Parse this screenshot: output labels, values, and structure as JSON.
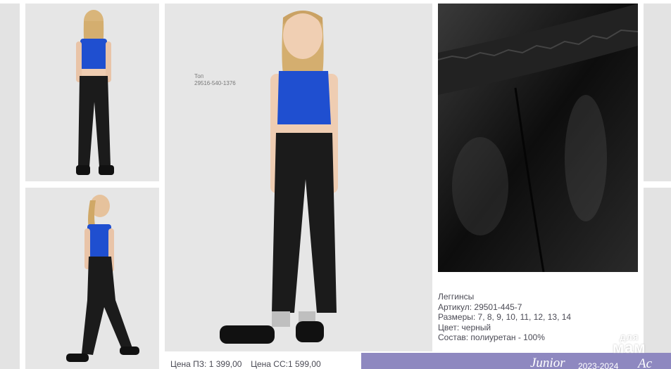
{
  "top_note": {
    "name": "Топ",
    "article": "29516-540-1376"
  },
  "product": {
    "name": "Леггинсы",
    "article": "Артикул: 29501-445-7",
    "sizes": "Размеры: 7, 8, 9, 10, 11, 12, 13, 14",
    "color": "Цвет: черный",
    "composition": "Состав: полиуретан - 100%"
  },
  "prices": {
    "pz": "Цена ПЗ: 1 399,00",
    "ss": "Цена СС:1 599,00"
  },
  "footer": {
    "brand": "Junior",
    "season": "2023-2024",
    "brand_right": "Ac"
  },
  "watermark": {
    "line1": "для",
    "line2": "мам"
  },
  "colors": {
    "top": "#1f4fd0",
    "leggings": "#1b1b1b",
    "accent_bar": "#8e88c0"
  }
}
